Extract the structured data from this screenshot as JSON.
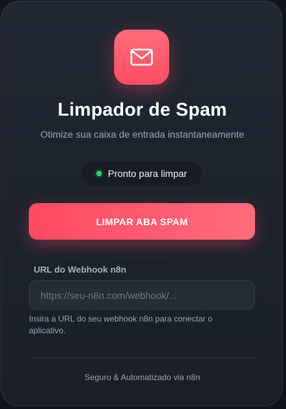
{
  "header": {
    "icon": "mail-icon",
    "title": "Limpador de Spam",
    "subtitle": "Otimize sua caixa de entrada instantaneamente"
  },
  "status": {
    "text": "Pronto para limpar",
    "color": "#22d36b"
  },
  "action": {
    "clean_label": "LIMPAR ABA SPAM"
  },
  "webhook": {
    "label": "URL do Webhook n8n",
    "value": "",
    "placeholder": "https://seu-n8n.com/webhook/...",
    "hint": "Insira a URL do seu webhook n8n para conectar o aplicativo."
  },
  "footer": {
    "text": "Seguro & Automatizado via n8n"
  },
  "colors": {
    "accent": "#ff4d63",
    "background": "#1c222c"
  }
}
